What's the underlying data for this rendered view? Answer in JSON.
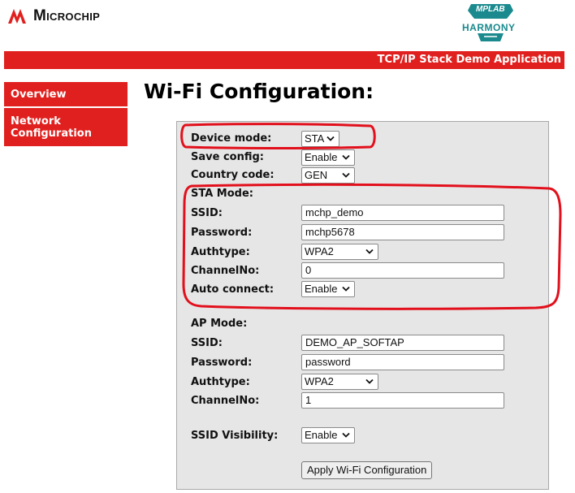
{
  "header": {
    "microchip_logo_text": "Microchip",
    "harmony_logo_text_top": "MPLAB",
    "harmony_logo_text": "HARMONY",
    "banner_text": "TCP/IP Stack Demo Application"
  },
  "sidebar": {
    "items": [
      {
        "label": "Overview"
      },
      {
        "label": "Network\nConfiguration"
      }
    ]
  },
  "main": {
    "title": "Wi-Fi Configuration:"
  },
  "form": {
    "device_mode": {
      "label": "Device mode:",
      "value": "STA"
    },
    "save_config": {
      "label": "Save config:",
      "value": "Enable"
    },
    "country_code": {
      "label": "Country code:",
      "value": "GEN"
    },
    "sta": {
      "heading": "STA Mode:",
      "ssid": {
        "label": "SSID:",
        "value": "mchp_demo"
      },
      "password": {
        "label": "Password:",
        "value": "mchp5678"
      },
      "authtype": {
        "label": "Authtype:",
        "value": "WPA2"
      },
      "channel": {
        "label": "ChannelNo:",
        "value": "0"
      },
      "auto_connect": {
        "label": "Auto connect:",
        "value": "Enable"
      }
    },
    "ap": {
      "heading": "AP Mode:",
      "ssid": {
        "label": "SSID:",
        "value": "DEMO_AP_SOFTAP"
      },
      "password": {
        "label": "Password:",
        "value": "password"
      },
      "authtype": {
        "label": "Authtype:",
        "value": "WPA2"
      },
      "channel": {
        "label": "ChannelNo:",
        "value": "1"
      },
      "ssid_visibility": {
        "label": "SSID Visibility:",
        "value": "Enable"
      }
    },
    "apply_label": "Apply Wi-Fi Configuration"
  },
  "colors": {
    "brand_red": "#e0201e",
    "panel_bg": "#e6e6e6",
    "harmony_teal": "#1a8a8e",
    "highlight_red": "#e2101c"
  },
  "icons": [
    "microchip-logo-icon",
    "mplab-harmony-logo-icon",
    "chevron-down-icon"
  ]
}
